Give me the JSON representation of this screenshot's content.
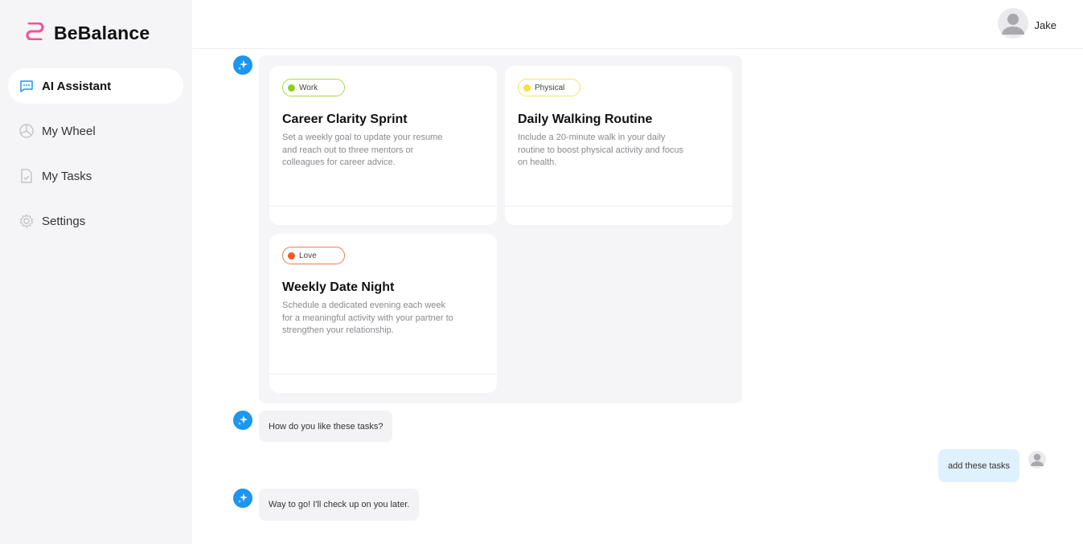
{
  "brand": {
    "name": "BeBalance"
  },
  "sidebar": {
    "items": [
      {
        "label": "AI Assistant",
        "icon": "chat-icon",
        "active": true
      },
      {
        "label": "My Wheel",
        "icon": "wheel-icon",
        "active": false
      },
      {
        "label": "My Tasks",
        "icon": "tasks-icon",
        "active": false
      },
      {
        "label": "Settings",
        "icon": "gear-icon",
        "active": false
      }
    ]
  },
  "header": {
    "user_name": "Jake"
  },
  "tasks": [
    {
      "tag": "Work",
      "tag_color": "#8ccf1e",
      "tag_border": "#a7d94a",
      "title": "Career Clarity Sprint",
      "description": "Set a weekly goal to update your resume and reach out to three mentors or colleagues for career advice."
    },
    {
      "tag": "Physical",
      "tag_color": "#f2e23a",
      "tag_border": "#ede66a",
      "title": "Daily Walking Routine",
      "description": "Include a 20-minute walk in your daily routine to boost physical activity and focus on health."
    },
    {
      "tag": "Love",
      "tag_color": "#f05a2a",
      "tag_border": "#ee7a4e",
      "title": "Weekly Date Night",
      "description": "Schedule a dedicated evening each week for a meaningful activity with your partner to strengthen your relationship."
    }
  ],
  "messages": [
    {
      "from": "assistant",
      "text": "How do you like these tasks?"
    },
    {
      "from": "user",
      "text": "add these tasks"
    },
    {
      "from": "assistant",
      "text": "Way to go! I'll check up on you later."
    }
  ],
  "colors": {
    "accent": "#1c96f0",
    "brand_pink": "#f0559a",
    "sidebar_bg": "#f5f5f8",
    "user_bubble": "#dff1fd"
  }
}
